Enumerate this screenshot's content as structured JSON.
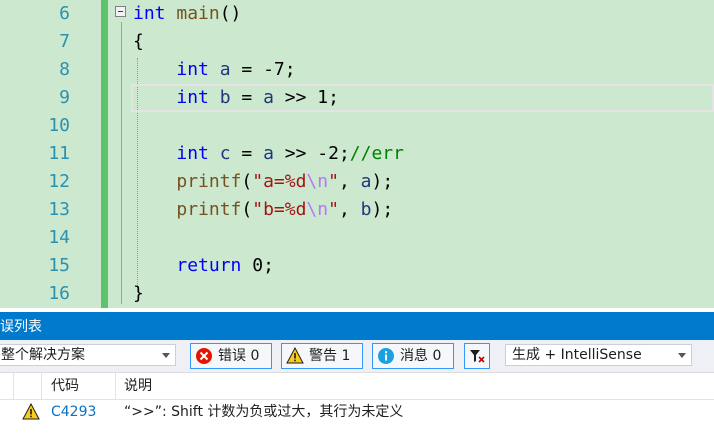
{
  "editor": {
    "line_numbers": [
      "6",
      "7",
      "8",
      "9",
      "10",
      "11",
      "12",
      "13",
      "14",
      "15",
      "16"
    ],
    "lines": [
      [
        {
          "t": "int",
          "c": "kw"
        },
        {
          "t": " ",
          "c": ""
        },
        {
          "t": "main",
          "c": "fn"
        },
        {
          "t": "()",
          "c": ""
        }
      ],
      [
        {
          "t": "{",
          "c": ""
        }
      ],
      [
        {
          "t": "    ",
          "c": ""
        },
        {
          "t": "int",
          "c": "kw"
        },
        {
          "t": " ",
          "c": ""
        },
        {
          "t": "a",
          "c": "var"
        },
        {
          "t": " = -7;",
          "c": ""
        }
      ],
      [
        {
          "t": "    ",
          "c": ""
        },
        {
          "t": "int",
          "c": "kw"
        },
        {
          "t": " ",
          "c": ""
        },
        {
          "t": "b",
          "c": "var"
        },
        {
          "t": " = ",
          "c": ""
        },
        {
          "t": "a",
          "c": "var"
        },
        {
          "t": " >> 1;",
          "c": ""
        }
      ],
      [],
      [
        {
          "t": "    ",
          "c": ""
        },
        {
          "t": "int",
          "c": "kw"
        },
        {
          "t": " ",
          "c": ""
        },
        {
          "t": "c",
          "c": "var"
        },
        {
          "t": " = ",
          "c": ""
        },
        {
          "t": "a",
          "c": "var"
        },
        {
          "t": " >> -2;",
          "c": ""
        },
        {
          "t": "//err",
          "c": "cm"
        }
      ],
      [
        {
          "t": "    ",
          "c": ""
        },
        {
          "t": "printf",
          "c": "fn"
        },
        {
          "t": "(",
          "c": ""
        },
        {
          "t": "\"a=%d",
          "c": "str"
        },
        {
          "t": "\\n",
          "c": "esc"
        },
        {
          "t": "\"",
          "c": "str"
        },
        {
          "t": ", ",
          "c": ""
        },
        {
          "t": "a",
          "c": "var"
        },
        {
          "t": ");",
          "c": ""
        }
      ],
      [
        {
          "t": "    ",
          "c": ""
        },
        {
          "t": "printf",
          "c": "fn"
        },
        {
          "t": "(",
          "c": ""
        },
        {
          "t": "\"b=%d",
          "c": "str"
        },
        {
          "t": "\\n",
          "c": "esc"
        },
        {
          "t": "\"",
          "c": "str"
        },
        {
          "t": ", ",
          "c": ""
        },
        {
          "t": "b",
          "c": "var"
        },
        {
          "t": ");",
          "c": ""
        }
      ],
      [],
      [
        {
          "t": "    ",
          "c": ""
        },
        {
          "t": "return",
          "c": "kw"
        },
        {
          "t": " 0;",
          "c": ""
        }
      ],
      [
        {
          "t": "}",
          "c": ""
        }
      ]
    ]
  },
  "error_list": {
    "title": "误列表",
    "scope_combo": "整个解决方案",
    "errors_label": "错误 0",
    "warnings_label": "警告 1",
    "messages_label": "消息 0",
    "build_combo": "生成 + IntelliSense",
    "columns": {
      "code": "代码",
      "description": "说明"
    },
    "rows": [
      {
        "code": "C4293",
        "description": "“>>”: Shift 计数为负或过大，其行为未定义"
      }
    ]
  },
  "colors": {
    "editor_bg": "#cce8cf",
    "line_number": "#2b91af",
    "keyword": "#0000ff",
    "accent": "#007acc"
  },
  "icons": [
    "error-icon",
    "warning-icon",
    "info-icon",
    "filter-icon",
    "chevron-down-icon",
    "fold-collapse-icon"
  ]
}
